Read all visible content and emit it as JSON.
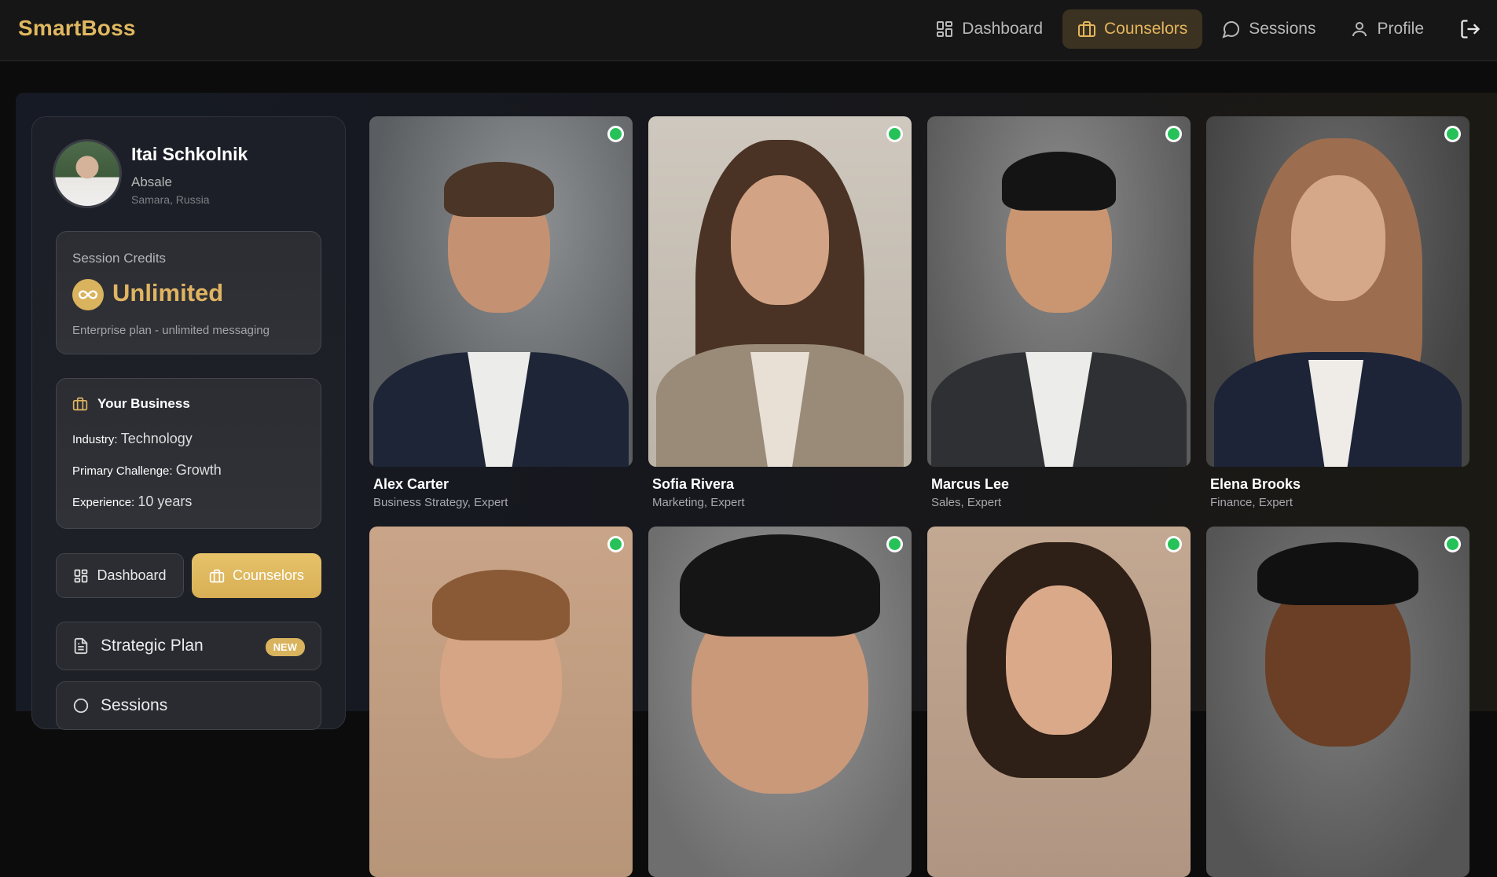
{
  "app": {
    "name": "SmartBoss"
  },
  "nav": {
    "items": [
      {
        "label": "Dashboard",
        "icon": "grid-icon"
      },
      {
        "label": "Counselors",
        "icon": "briefcase-icon",
        "active": true
      },
      {
        "label": "Sessions",
        "icon": "chat-bubble-icon"
      },
      {
        "label": "Profile",
        "icon": "user-icon"
      }
    ],
    "logout_icon": "logout-icon"
  },
  "user": {
    "name": "Itai Schkolnik",
    "company": "Absale",
    "location": "Samara, Russia"
  },
  "credits": {
    "title": "Session Credits",
    "value": "Unlimited",
    "description": "Enterprise plan - unlimited messaging"
  },
  "business": {
    "title": "Your Business",
    "industry_label": "Industry:",
    "industry_value": "Technology",
    "challenge_label": "Primary Challenge:",
    "challenge_value": "Growth",
    "experience_label": "Experience:",
    "experience_value": "10 years"
  },
  "sidebar_buttons": {
    "dashboard": "Dashboard",
    "counselors": "Counselors"
  },
  "sidebar_menu": {
    "strategic_plan": "Strategic Plan",
    "new_badge": "NEW",
    "sessions": "Sessions"
  },
  "counselors": [
    {
      "name": "Alex Carter",
      "role": "Business Strategy, Expert",
      "online": true
    },
    {
      "name": "Sofia Rivera",
      "role": "Marketing, Expert",
      "online": true
    },
    {
      "name": "Marcus Lee",
      "role": "Sales, Expert",
      "online": true
    },
    {
      "name": "Elena Brooks",
      "role": "Finance, Expert",
      "online": true
    },
    {
      "name": "",
      "role": "",
      "online": true
    },
    {
      "name": "",
      "role": "",
      "online": true
    },
    {
      "name": "",
      "role": "",
      "online": true
    },
    {
      "name": "",
      "role": "",
      "online": true
    }
  ],
  "colors": {
    "accent": "#e0b461",
    "online": "#26c259",
    "background": "#0c0c0c"
  }
}
